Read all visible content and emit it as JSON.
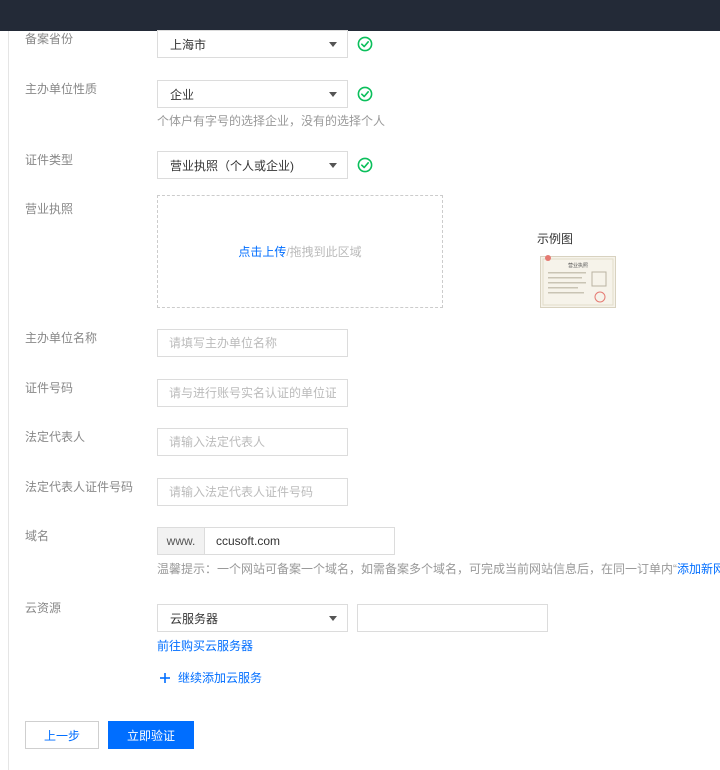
{
  "form": {
    "province": {
      "label": "备案省份",
      "value": "上海市"
    },
    "org_nature": {
      "label": "主办单位性质",
      "value": "企业",
      "hint": "个体户有字号的选择企业，没有的选择个人"
    },
    "cert_type": {
      "label": "证件类型",
      "value": "营业执照（个人或企业)"
    },
    "business_license": {
      "label": "营业执照",
      "upload_link": "点击上传",
      "upload_rest": "/拖拽到此区域",
      "example_title": "示例图",
      "example_image_icon": "business-license-sample-image",
      "example_image_text": "营业执照"
    },
    "org_name": {
      "label": "主办单位名称",
      "placeholder": "请填写主办单位名称"
    },
    "cert_number": {
      "label": "证件号码",
      "placeholder": "请与进行账号实名认证的单位证件"
    },
    "legal_rep": {
      "label": "法定代表人",
      "placeholder": "请输入法定代表人"
    },
    "legal_rep_id": {
      "label": "法定代表人证件号码",
      "placeholder": "请输入法定代表人证件号码"
    },
    "domain": {
      "label": "域名",
      "prefix": "www.",
      "value": "ccusoft.com",
      "tip": "温馨提示：一个网站可备案一个域名，如需备案多个域名，可完成当前网站信息后，在同一订单内“",
      "tip_link": "添加新网站"
    },
    "cloud": {
      "label": "云资源",
      "select_value": "云服务器",
      "input_value": "",
      "buy_link": "前往购买云服务器",
      "add_label": "继续添加云服务"
    }
  },
  "buttons": {
    "prev": "上一步",
    "verify": "立即验证"
  },
  "icons": {
    "valid": "check-circle-icon",
    "dropdown": "chevron-down-icon",
    "add": "plus-icon"
  },
  "colors": {
    "topbar": "#232a37",
    "primary": "#006eff",
    "success": "#0abf5b",
    "label": "#888888",
    "hint": "#999999",
    "border": "#dcdcdc"
  }
}
